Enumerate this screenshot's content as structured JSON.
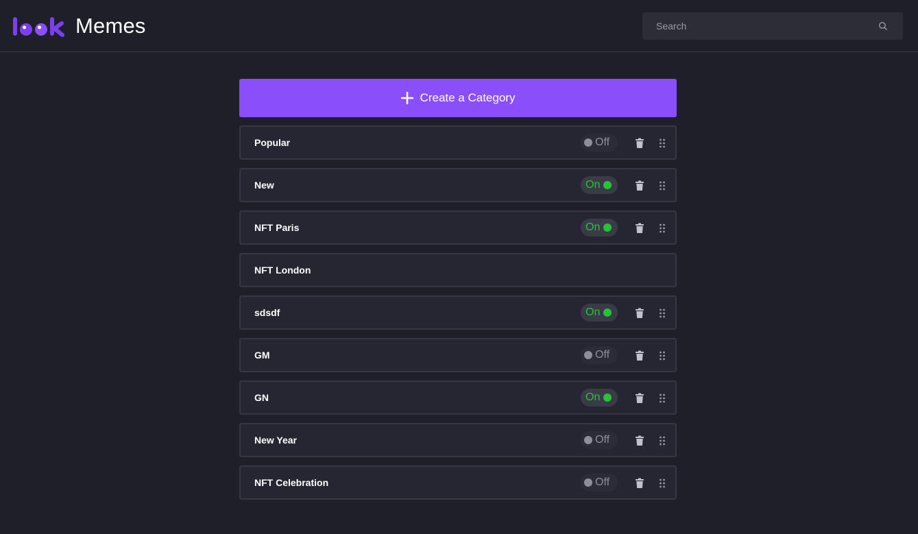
{
  "brand": {
    "name": "Memes",
    "logo_icon": "look-logo"
  },
  "search": {
    "placeholder": "Search",
    "value": "",
    "icon": "search-icon"
  },
  "create_button": {
    "label": "Create a Category",
    "icon": "plus-icon"
  },
  "colors": {
    "accent": "#8a4ffb",
    "on": "#23c33a",
    "off": "#8e8e9b",
    "background": "#1f1f29"
  },
  "categories": [
    {
      "name": "Popular",
      "state": "off",
      "state_label": "Off",
      "has_controls": true
    },
    {
      "name": "New",
      "state": "on",
      "state_label": "On",
      "has_controls": true
    },
    {
      "name": "NFT Paris",
      "state": "on",
      "state_label": "On",
      "has_controls": true
    },
    {
      "name": "NFT London",
      "state": "",
      "state_label": "",
      "has_controls": false
    },
    {
      "name": "sdsdf",
      "state": "on",
      "state_label": "On",
      "has_controls": true
    },
    {
      "name": "GM",
      "state": "off",
      "state_label": "Off",
      "has_controls": true
    },
    {
      "name": "GN",
      "state": "on",
      "state_label": "On",
      "has_controls": true
    },
    {
      "name": "New Year",
      "state": "off",
      "state_label": "Off",
      "has_controls": true
    },
    {
      "name": "NFT Celebration",
      "state": "off",
      "state_label": "Off",
      "has_controls": true
    }
  ]
}
